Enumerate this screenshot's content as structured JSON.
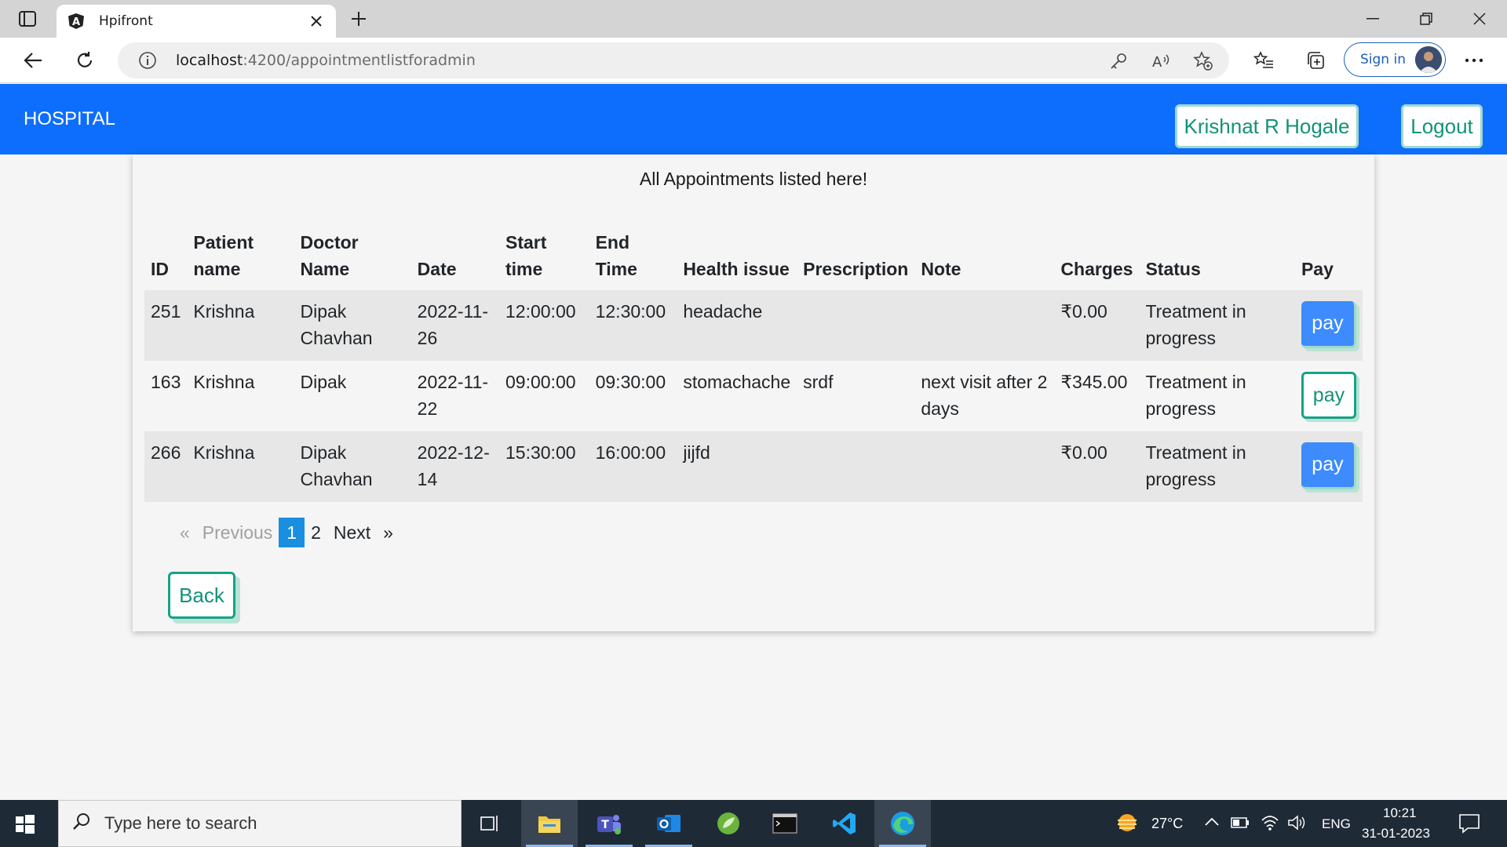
{
  "browser": {
    "tab_title": "Hpifront",
    "url_host": "localhost",
    "url_path": ":4200/appointmentlistforadmin",
    "signin_label": "Sign in"
  },
  "header": {
    "brand": "HOSPITAL",
    "user_button": "Krishnat R Hogale",
    "logout_button": "Logout"
  },
  "main": {
    "heading": "All Appointments listed here!",
    "columns": [
      [
        "ID"
      ],
      [
        "Patient",
        "name"
      ],
      [
        "Doctor",
        "Name"
      ],
      [
        "Date"
      ],
      [
        "Start",
        "time"
      ],
      [
        "End",
        "Time"
      ],
      [
        "Health issue"
      ],
      [
        "Prescription"
      ],
      [
        "Note"
      ],
      [
        "Charges"
      ],
      [
        "Status"
      ],
      [
        "Pay"
      ]
    ],
    "rows": [
      {
        "id": "251",
        "patient": "Krishna",
        "doctor_1": "Dipak",
        "doctor_2": "Chavhan",
        "date_1": "2022-11-",
        "date_2": "26",
        "start": "12:00:00",
        "end": "12:30:00",
        "issue": "headache",
        "prescription": "",
        "note_1": "",
        "note_2": "",
        "charges": "₹0.00",
        "status_1": "Treatment in",
        "status_2": "progress",
        "pay_label": "pay",
        "pay_style": "filled"
      },
      {
        "id": "163",
        "patient": "Krishna",
        "doctor_1": "Dipak",
        "doctor_2": "",
        "date_1": "2022-11-",
        "date_2": "22",
        "start": "09:00:00",
        "end": "09:30:00",
        "issue": "stomachache",
        "prescription": "srdf",
        "note_1": "next visit after 2",
        "note_2": "days",
        "charges": "₹345.00",
        "status_1": "Treatment in",
        "status_2": "progress",
        "pay_label": "pay",
        "pay_style": "outline"
      },
      {
        "id": "266",
        "patient": "Krishna",
        "doctor_1": "Dipak",
        "doctor_2": "Chavhan",
        "date_1": "2022-12-",
        "date_2": "14",
        "start": "15:30:00",
        "end": "16:00:00",
        "issue": "jijfd",
        "prescription": "",
        "note_1": "",
        "note_2": "",
        "charges": "₹0.00",
        "status_1": "Treatment in",
        "status_2": "progress",
        "pay_label": "pay",
        "pay_style": "filled"
      }
    ],
    "pagination": {
      "prev_arrow": "«",
      "prev_label": "Previous",
      "pages": [
        "1",
        "2"
      ],
      "active_page": "1",
      "next_label": "Next",
      "next_arrow": "»"
    },
    "back_button": "Back"
  },
  "taskbar": {
    "search_placeholder": "Type here to search",
    "temperature": "27°C",
    "language": "ENG",
    "time": "10:21",
    "date": "31-01-2023"
  },
  "colors": {
    "header_bg": "#0d6efd",
    "accent_green": "#11927a",
    "pay_blue": "#3d8bfd",
    "active_page": "#1a8fe0"
  }
}
